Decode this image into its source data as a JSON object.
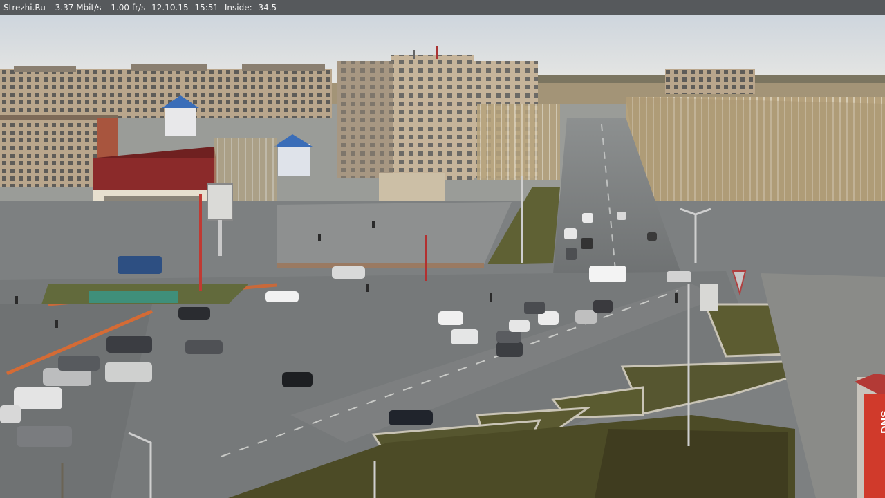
{
  "overlay": {
    "site": "Strezhi.Ru",
    "bitrate": "3.37 Mbit/s",
    "framerate": "1.00 fr/s",
    "date": "12.10.15",
    "time": "15:51",
    "inside_label": "Inside:",
    "inside_value": "34.5"
  },
  "signs": {
    "store_sign": "DNS"
  },
  "colors": {
    "sky_top": "#cfd6df",
    "sky_bottom": "#e3e4e2",
    "asphalt": "#7c7f80",
    "asphalt_light": "#8f9292",
    "grass": "#5b5a32",
    "building_facade": "#c9b79e",
    "building_roof_red": "#8b2a2a",
    "roof_blue": "#3a6db8",
    "trees": "#b9a47e",
    "store_red": "#d03a2b"
  }
}
